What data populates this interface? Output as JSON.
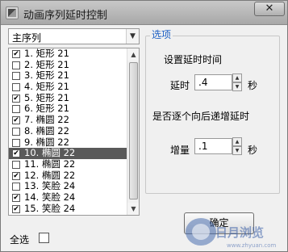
{
  "window": {
    "title": "动画序列延时控制",
    "close_glyph": "✕"
  },
  "sequence_select": {
    "value": "主序列",
    "arrow": "▼"
  },
  "list": {
    "items": [
      {
        "label": "1. 矩形 21",
        "checked": true
      },
      {
        "label": "2. 矩形 21",
        "checked": false
      },
      {
        "label": "3. 矩形 21",
        "checked": false
      },
      {
        "label": "4. 矩形 21",
        "checked": false
      },
      {
        "label": "5. 矩形 21",
        "checked": true
      },
      {
        "label": "6. 矩形 21",
        "checked": false
      },
      {
        "label": "7. 椭圆 22",
        "checked": true
      },
      {
        "label": "8. 椭圆 22",
        "checked": false
      },
      {
        "label": "9. 椭圆 22",
        "checked": false
      },
      {
        "label": "10. 椭圆 22",
        "checked": true,
        "selected": true
      },
      {
        "label": "11. 椭圆 22",
        "checked": false
      },
      {
        "label": "12. 椭圆 22",
        "checked": true
      },
      {
        "label": "13. 笑脸 24",
        "checked": false
      },
      {
        "label": "14. 笑脸 24",
        "checked": true
      },
      {
        "label": "15. 笑脸 24",
        "checked": true
      }
    ],
    "scroll_up": "▲",
    "scroll_down": "▼"
  },
  "select_all": {
    "label": "全选",
    "checked": false
  },
  "options": {
    "group_title": "选项",
    "delay_heading": "设置延时时间",
    "delay_label": "延时",
    "delay_value": ".4",
    "delay_unit": "秒",
    "increment_heading": "是否逐个向后递增延时",
    "increment_label": "增量",
    "increment_value": ".1",
    "increment_unit": "秒",
    "spin_up": "▲",
    "spin_down": "▼"
  },
  "ok_button": {
    "label": "确定"
  },
  "watermark": {
    "brand": "日月浏览",
    "url": "www.zhyuan.com"
  },
  "colors": {
    "accent": "#1c5fc4",
    "selection": "#5a5a5a"
  }
}
